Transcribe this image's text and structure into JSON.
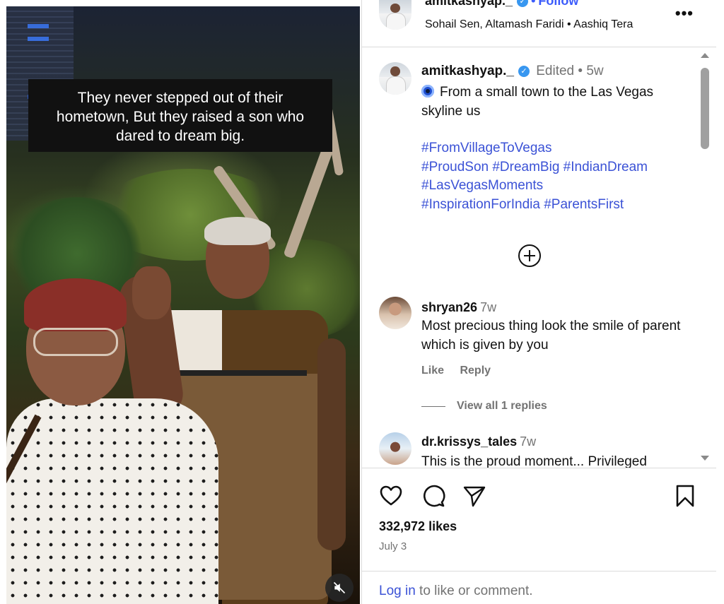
{
  "media": {
    "caption_lines": [
      "They never stepped out of their",
      "hometown, But they raised a son who",
      "dared to dream big."
    ],
    "mute_icon": "speaker-muted-icon"
  },
  "header": {
    "username": "amitkashyap._",
    "verified_icon": "verified-badge-icon",
    "separator": "•",
    "follow_label": "Follow",
    "audio": "Sohail Sen, Altamash Faridi • Aashiq Tera",
    "more_label": "•••"
  },
  "caption": {
    "username": "amitkashyap._",
    "meta": "Edited • 5w",
    "text": "From a small town to the Las Vegas skyline us",
    "hashtags": [
      "#FromVillageToVegas",
      "#ProudSon #DreamBig #IndianDream",
      "#LasVegasMoments",
      "#InspirationForIndia #ParentsFirst"
    ]
  },
  "comments": [
    {
      "username": "shryan26",
      "time": "7w",
      "text": "Most precious thing look the smile of parent which is given by you",
      "like_label": "Like",
      "reply_label": "Reply",
      "view_replies": "View all 1 replies"
    },
    {
      "username": "dr.krissys_tales",
      "time": "7w",
      "text": "This is the proud moment... Privileged"
    }
  ],
  "stats": {
    "likes": "332,972 likes",
    "date": "July 3"
  },
  "footer": {
    "login_link": "Log in",
    "login_rest": " to like or comment."
  },
  "colors": {
    "link_blue": "#3b52d6",
    "follow_blue": "#3b5bfb",
    "muted_text": "#737373",
    "border": "#dbdbdb"
  }
}
